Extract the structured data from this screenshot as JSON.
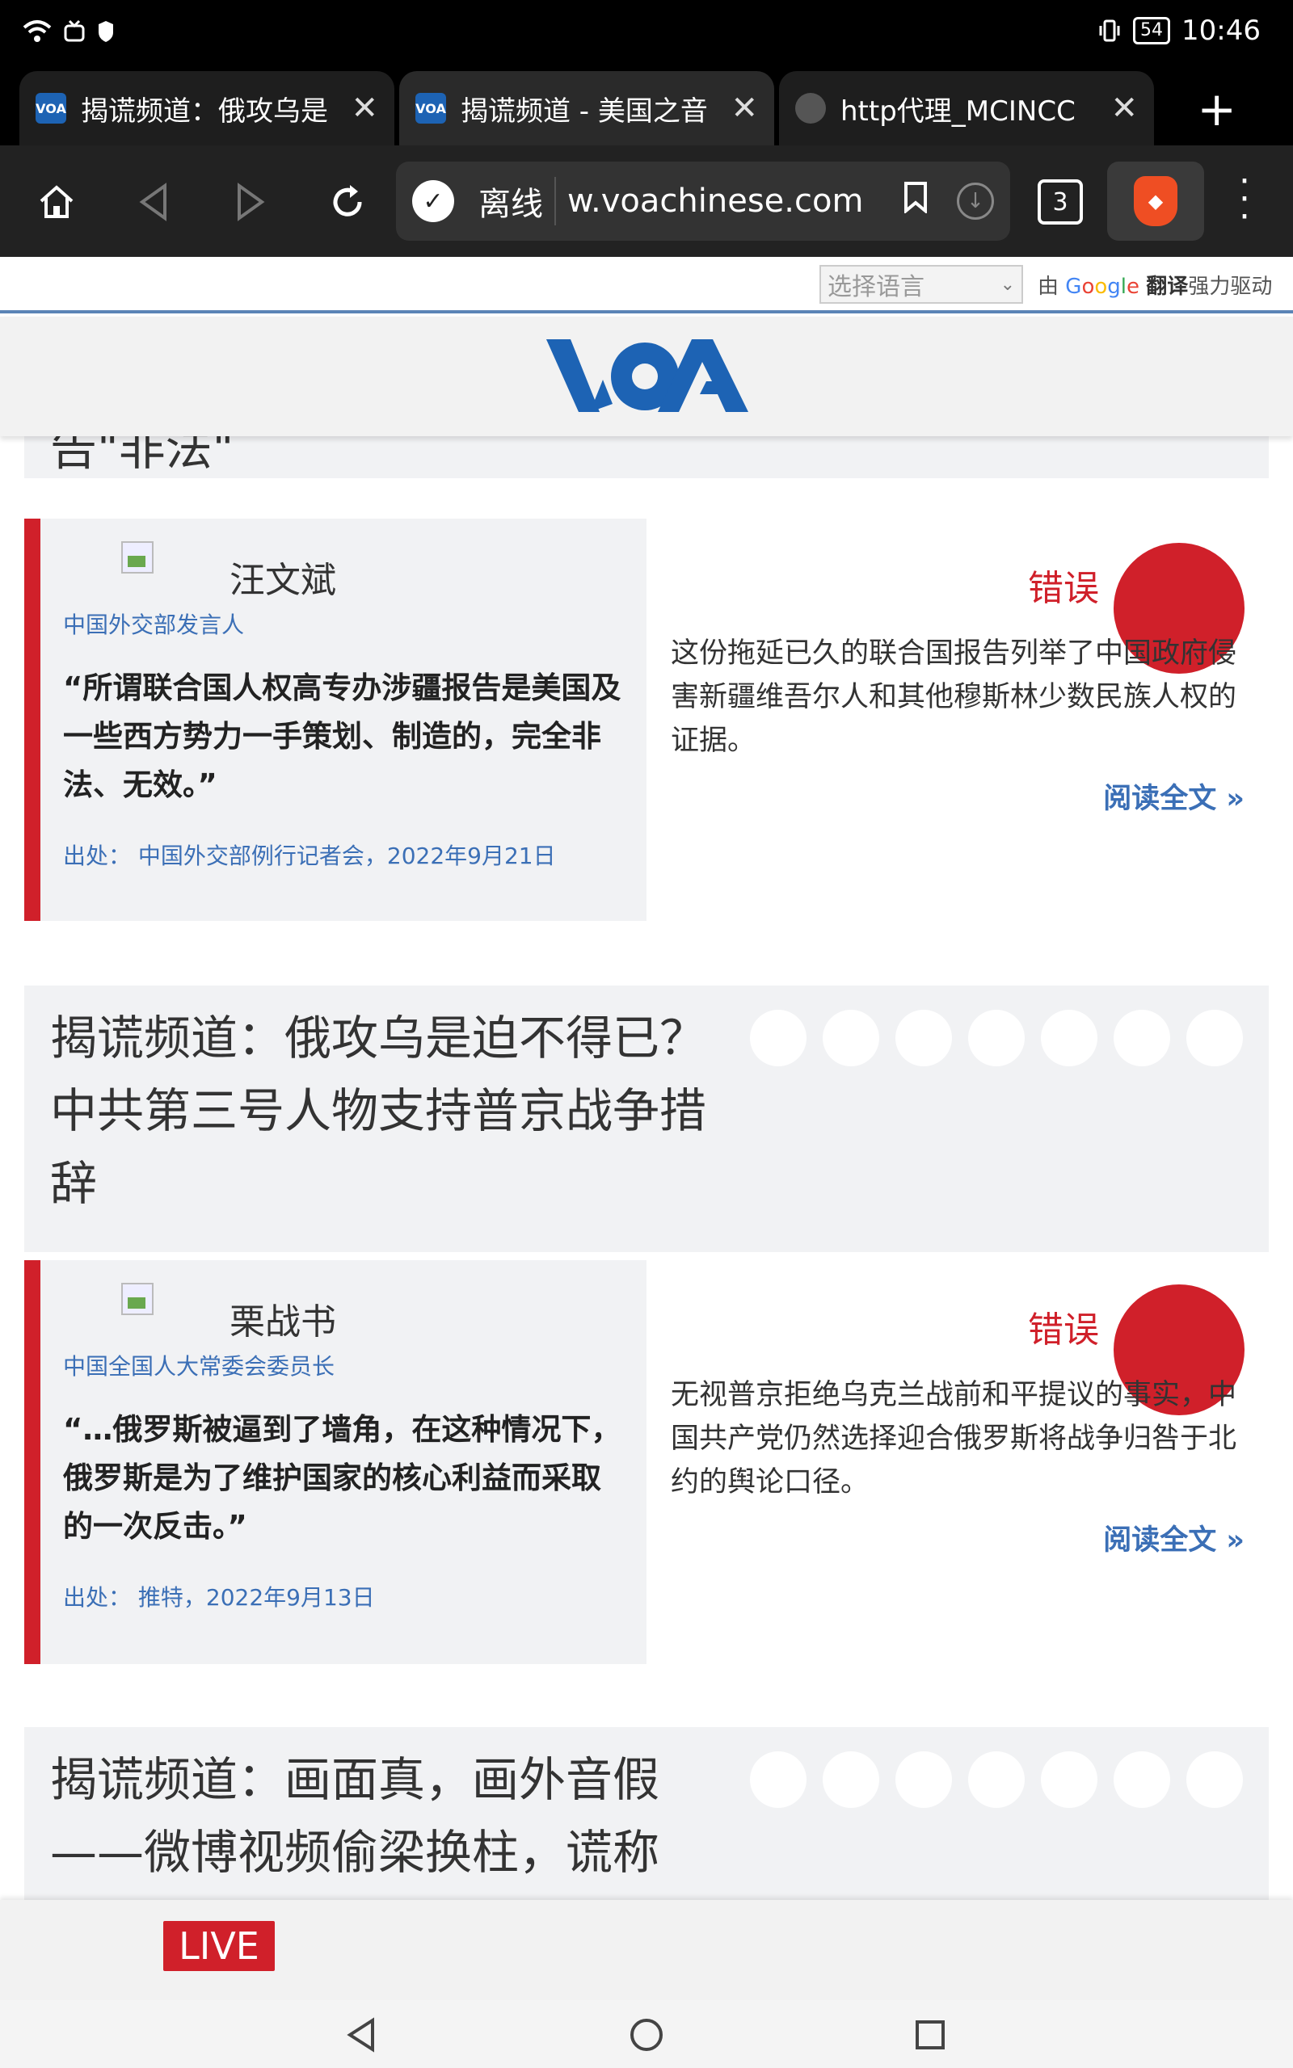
{
  "status_bar": {
    "time": "10:46",
    "battery": "54"
  },
  "tabs": [
    {
      "title": "揭谎频道：俄攻乌是",
      "favicon": "VOA"
    },
    {
      "title": "揭谎频道 - 美国之音",
      "favicon": "VOA"
    },
    {
      "title": "http代理_MCINCC",
      "favicon": "globe"
    }
  ],
  "toolbar": {
    "url_status": "离线",
    "url": "w.voachinese.com",
    "tab_count": "3"
  },
  "translate_bar": {
    "select_placeholder": "选择语言",
    "powered_prefix": "由",
    "powered_brand": "Google",
    "powered_product": "翻译",
    "powered_suffix": "强力驱动"
  },
  "site": {
    "logo": "VOA"
  },
  "partial_top_title": "告\"非法\"",
  "cards": [
    {
      "person_name": "汪文斌",
      "person_role": "中国外交部发言人",
      "quote": "“所谓联合国人权高专办涉疆报告是美国及一些西方势力一手策划、制造的，完全非法、无效。”",
      "source": "出处：  中国外交部例行记者会，2022年9月21日",
      "verdict": "错误",
      "explanation": "这份拖延已久的联合国报告列举了中国政府侵害新疆维吾尔人和其他穆斯林少数民族人权的证据。",
      "read_more": "阅读全文 »"
    },
    {
      "title": "揭谎频道：俄攻乌是迫不得已？中共第三号人物支持普京战争措辞",
      "person_name": "栗战书",
      "person_role": "中国全国人大常委会委员长",
      "quote": "“…俄罗斯被逼到了墙角，在这种情况下，俄罗斯是为了维护国家的核心利益而采取的一次反击。”",
      "source": "出处：  推特，2022年9月13日",
      "verdict": "错误",
      "explanation": "无视普京拒绝乌克兰战前和平提议的事实，中国共产党仍然选择迎合俄罗斯将战争归咎于北约的舆论口径。",
      "read_more": "阅读全文 »"
    },
    {
      "title": "揭谎频道：画面真，画外音假——微博视频偷梁换柱，谎称"
    }
  ],
  "live_label": "LIVE",
  "colors": {
    "accent_red": "#d0202a",
    "link_blue": "#3b6fb6",
    "voa_blue": "#1d63b4"
  }
}
